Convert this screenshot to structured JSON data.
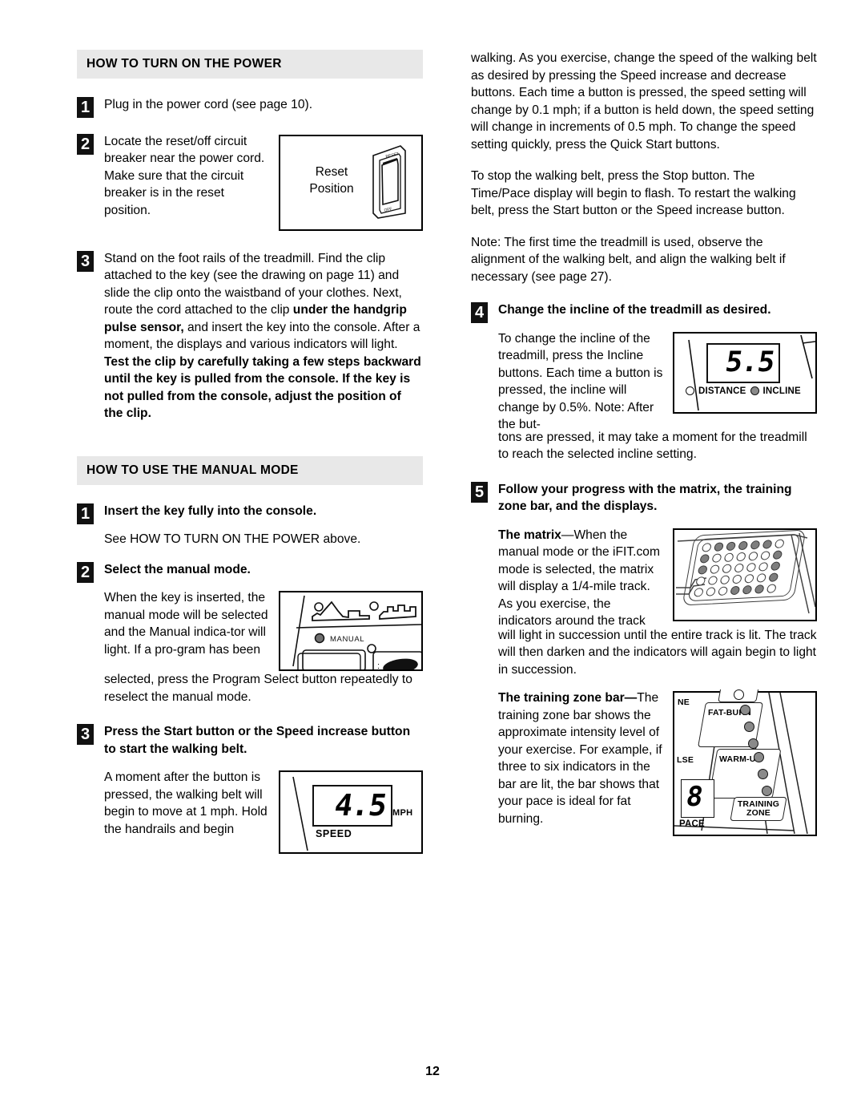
{
  "page": {
    "number": "12"
  },
  "left_column": {
    "section1": {
      "heading": "HOW TO TURN ON THE POWER",
      "steps": [
        {
          "num": "1",
          "text": "Plug in the power cord (see page 10)."
        },
        {
          "num": "2",
          "text": "Locate the reset/off circuit breaker near the power cord. Make sure that the circuit breaker is in the reset position.",
          "figure": {
            "name": "reset-position-figure",
            "label_line1": "Reset",
            "label_line2": "Position",
            "switch_top_label": "RESET",
            "switch_bottom_label": "OFF"
          }
        },
        {
          "num": "3",
          "text_part1": "Stand on the foot rails of the treadmill. Find the clip attached to the key (see the drawing on page 11) and slide the clip onto the waistband of your clothes. Next, route the cord attached to the clip ",
          "bold1": "under the handgrip pulse sensor,",
          "text_part2": " and insert the key into the console. After a moment, the displays and various indicators will light. ",
          "bold2": "Test the clip by carefully taking a few steps backward until the key is pulled from the console. If the key is not pulled from the console, adjust the position of the clip."
        }
      ]
    },
    "section2": {
      "heading": "HOW TO USE THE MANUAL MODE",
      "steps": [
        {
          "num": "1",
          "title": "Insert the key fully into the console.",
          "body": "See HOW TO TURN ON THE POWER above."
        },
        {
          "num": "2",
          "title": "Select the manual mode.",
          "body_wrap": "When the key is inserted, the manual mode will be selected and the Manual indica-tor will light. If a pro-gram has been",
          "body_full": "selected, press the Program Select button repeatedly to reselect the manual mode.",
          "figure": {
            "name": "manual-indicator-figure",
            "indicator_label": "MANUAL"
          }
        },
        {
          "num": "3",
          "title": "Press the Start button or the Speed increase button to start the walking belt.",
          "body": "A moment after the button is pressed, the walking belt will begin to move at 1 mph. Hold the handrails and begin",
          "figure": {
            "name": "speed-display-figure",
            "value": "4.5",
            "unit": "MPH",
            "caption": "SPEED"
          }
        }
      ]
    }
  },
  "right_column": {
    "continuation": [
      "walking. As you exercise, change the speed of the walking belt as desired by pressing the Speed increase and decrease buttons. Each time a button is pressed, the speed setting will change by 0.1 mph; if a button is held down, the speed setting will change in increments of 0.5 mph. To change the speed setting quickly, press the Quick Start buttons.",
      "To stop the walking belt, press the Stop button. The Time/Pace display will begin to flash. To restart the walking belt, press the Start button or the Speed increase button.",
      "Note: The first time the treadmill is used, observe the alignment of the walking belt, and align the walking belt if necessary (see page 27)."
    ],
    "steps": [
      {
        "num": "4",
        "title": "Change the incline of the treadmill as desired.",
        "body_wrap": "To change the incline of the treadmill, press the Incline buttons. Each time a button is pressed, the incline will change by 0.5%. Note: After the but-",
        "body_full": "tons are pressed, it may take a moment for the treadmill to reach the selected incline setting.",
        "figure": {
          "name": "incline-display-figure",
          "value": "5.5",
          "led_distance_label": "DISTANCE",
          "led_incline_label": "INCLINE"
        }
      },
      {
        "num": "5",
        "title": "Follow your progress with the matrix, the training zone bar, and the displays.",
        "matrix_bold": "The matrix",
        "matrix_text_wrap": "—When the manual mode or the iFIT.com mode is selected, the matrix will display a 1/4-mile track. As you exercise, the indicators around the track",
        "matrix_text_full": "will light in succession until the entire track is lit. The track will then darken and the indicators will again begin to light in succession.",
        "zone_bold": "The training zone bar—",
        "zone_text": "The training zone bar shows the approximate intensity level of your exercise. For example, if three to six indicators in the bar are lit, the bar shows that your pace is ideal for fat burning.",
        "matrix_figure": {
          "name": "matrix-figure",
          "rows": [
            [
              0,
              1,
              1,
              1,
              1,
              1,
              0
            ],
            [
              1,
              0,
              0,
              0,
              0,
              0,
              1
            ],
            [
              1,
              0,
              0,
              0,
              0,
              0,
              1
            ],
            [
              0,
              0,
              0,
              0,
              0,
              0,
              1
            ],
            [
              0,
              0,
              0,
              1,
              1,
              1,
              0
            ]
          ]
        },
        "zone_figure": {
          "name": "training-zone-figure",
          "label_incline": "NE",
          "label_pulse": "LSE",
          "label_fatburn": "FAT-BURN",
          "label_warmup": "WARM-UP",
          "label_trainingzone_line1": "TRAINING",
          "label_trainingzone_line2": "ZONE",
          "label_pace": "PACE",
          "pace_value": "8"
        }
      }
    ]
  },
  "colors": {
    "heading_bg": "#e8e8e8",
    "step_num_bg": "#111111",
    "led_on": "#8a8a8a"
  }
}
